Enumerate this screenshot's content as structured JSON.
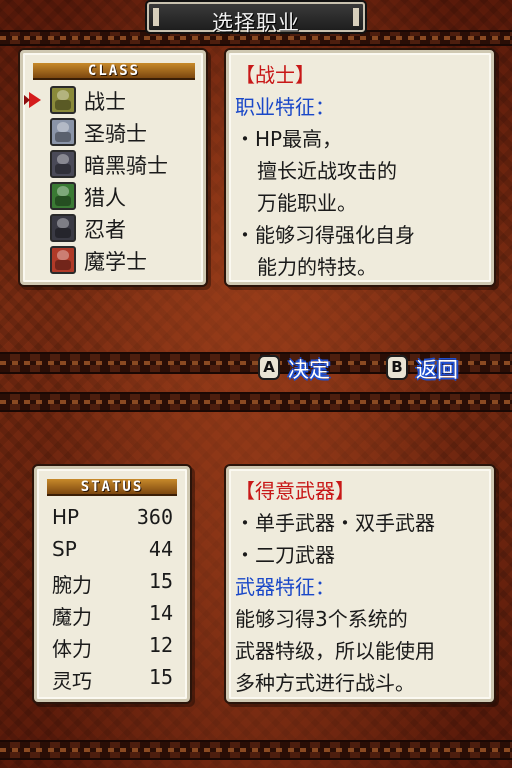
{
  "title": "选择职业",
  "colors": {
    "accent_red": "#c81818",
    "accent_blue": "#1a48c8",
    "parchment": "#efebdc",
    "header_gold": "#c88a2a"
  },
  "class_panel": {
    "header": "CLASS",
    "selected_index": 0,
    "items": [
      {
        "label": "战士",
        "icon": "warrior-portrait-icon",
        "color": "#8a8a3a"
      },
      {
        "label": "圣骑士",
        "icon": "paladin-portrait-icon",
        "color": "#8a94a8"
      },
      {
        "label": "暗黑骑士",
        "icon": "dark-knight-portrait-icon",
        "color": "#4a4a58"
      },
      {
        "label": "猎人",
        "icon": "hunter-portrait-icon",
        "color": "#3a7a34"
      },
      {
        "label": "忍者",
        "icon": "ninja-portrait-icon",
        "color": "#3a3a44"
      },
      {
        "label": "魔学士",
        "icon": "mage-portrait-icon",
        "color": "#b03a28"
      }
    ]
  },
  "class_desc": {
    "name": "【战士】",
    "feature_heading": "职业特征：",
    "lines": [
      "・HP最高，",
      "擅长近战攻击的",
      "万能职业。",
      "・能够习得强化自身",
      "能力的特技。"
    ]
  },
  "buttons": {
    "a_key": "A",
    "a_label": "决定",
    "b_key": "B",
    "b_label": "返回"
  },
  "status_panel": {
    "header": "STATUS",
    "stats": [
      {
        "name": "HP",
        "value": "360"
      },
      {
        "name": "SP",
        "value": "44"
      },
      {
        "name": "腕力",
        "value": "15"
      },
      {
        "name": "魔力",
        "value": "14"
      },
      {
        "name": "体力",
        "value": "12"
      },
      {
        "name": "灵巧",
        "value": "15"
      }
    ]
  },
  "weapon_desc": {
    "heading": "【得意武器】",
    "weapons_line1": "・单手武器・双手武器",
    "weapons_line2": "・二刀武器",
    "feature_heading": "武器特征：",
    "lines": [
      "能够习得3个系统的",
      "武器特级，所以能使用",
      "多种方式进行战斗。"
    ]
  }
}
